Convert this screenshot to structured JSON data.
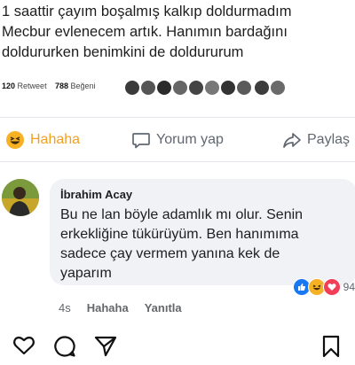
{
  "tweet": {
    "lines": [
      "1 saattir çayım boşalmış kalkıp doldurmadım",
      "Mecbur evlenecem artık. Hanımın bardağını",
      "doldururken benimkini de doldururum"
    ],
    "retweet_count": "120",
    "retweet_label": "Retweet",
    "like_count": "788",
    "like_label": "Beğeni"
  },
  "actions": {
    "haha_label": "Hahaha",
    "comment_label": "Yorum yap",
    "share_label": "Paylaş"
  },
  "comment": {
    "author": "İbrahim Acay",
    "lines": [
      "Bu ne lan böyle adamlık mı olur. Senin",
      "erkekliğine tükürüyüm. Ben hanımıma",
      "sadece çay vermem yanına kek de",
      "yaparım"
    ],
    "time": "4s",
    "haha_link": "Hahaha",
    "reply_link": "Yanıtla",
    "reaction_count": "94"
  },
  "colors": {
    "haha_yellow": "#f7b125",
    "like_blue": "#1877f2",
    "love_red": "#f33e58"
  },
  "instagram_bar": {
    "icons": [
      "heart-icon",
      "comment-icon",
      "send-icon",
      "bookmark-icon"
    ]
  }
}
